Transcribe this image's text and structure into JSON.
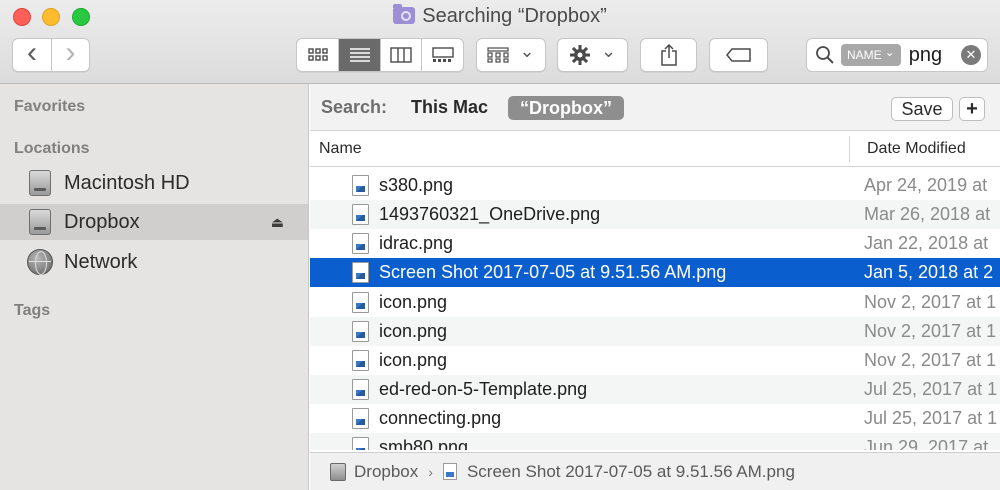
{
  "window": {
    "title": "Searching “Dropbox”"
  },
  "toolbar": {
    "back_glyph": "‹",
    "forward_glyph": "›",
    "view_icons": [
      "icon-view-icon",
      "list-view-icon",
      "column-view-icon",
      "gallery-view-icon"
    ],
    "active_view": "list-view",
    "arrange_chevron": "⌄",
    "action_chevron": "⌄"
  },
  "search": {
    "token": "NAME",
    "token_chevron": "⌄",
    "query": "png",
    "clear_glyph": "✕"
  },
  "sidebar": {
    "favorites_heading": "Favorites",
    "locations_heading": "Locations",
    "tags_heading": "Tags",
    "locations": [
      {
        "label": "Macintosh HD",
        "icon": "hard-disk-icon",
        "selected": false
      },
      {
        "label": "Dropbox",
        "icon": "hard-disk-icon",
        "selected": true,
        "eject": "⏏"
      },
      {
        "label": "Network",
        "icon": "network-globe-icon",
        "selected": false
      }
    ]
  },
  "scope": {
    "label": "Search:",
    "this_mac": "This Mac",
    "dropbox": "“Dropbox”",
    "save_label": "Save",
    "plus_label": "+"
  },
  "columns": {
    "name": "Name",
    "date_modified": "Date Modified"
  },
  "files": [
    {
      "name": "s380.png",
      "date": "Apr 24, 2019 at"
    },
    {
      "name": "1493760321_OneDrive.png",
      "date": "Mar 26, 2018 at"
    },
    {
      "name": "idrac.png",
      "date": "Jan 22, 2018 at"
    },
    {
      "name": "Screen Shot 2017-07-05 at 9.51.56 AM.png",
      "date": "Jan 5, 2018 at 2",
      "selected": true
    },
    {
      "name": "icon.png",
      "date": "Nov 2, 2017 at 1"
    },
    {
      "name": "icon.png",
      "date": "Nov 2, 2017 at 1"
    },
    {
      "name": "icon.png",
      "date": "Nov 2, 2017 at 1"
    },
    {
      "name": "ed-red-on-5-Template.png",
      "date": "Jul 25, 2017 at 1"
    },
    {
      "name": "connecting.png",
      "date": "Jul 25, 2017 at 1"
    },
    {
      "name": "smb80.png",
      "date": "Jun 29, 2017 at"
    }
  ],
  "pathbar": {
    "volume": "Dropbox",
    "separator": "›",
    "file": "Screen Shot 2017-07-05 at 9.51.56 AM.png"
  },
  "colors": {
    "selection": "#0a5ece",
    "sidebar_bg": "#e6e4e3",
    "close": "#fe5f57",
    "minimize": "#febc2e",
    "zoom": "#28c840"
  }
}
